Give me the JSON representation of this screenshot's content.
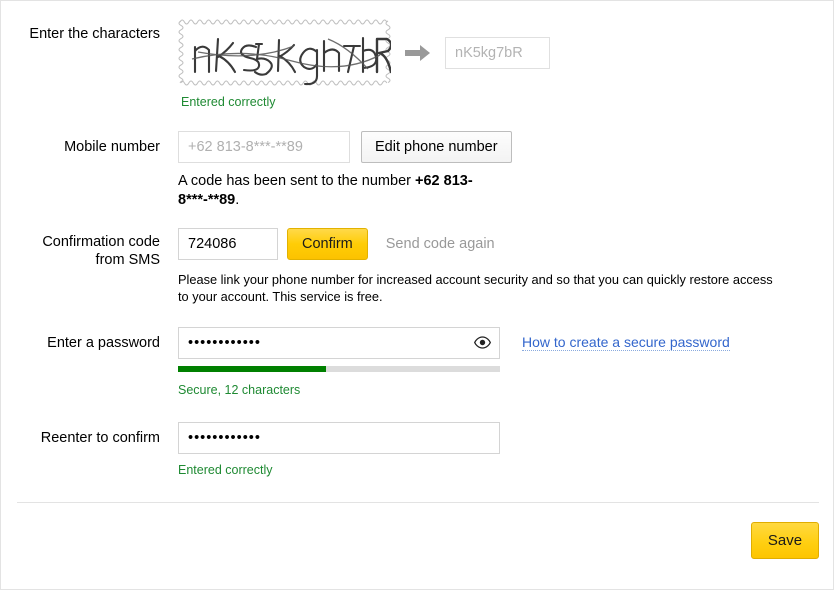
{
  "captcha": {
    "label": "Enter the characters",
    "image_text": "nK5kg7bR",
    "arrow_icon": "arrow-right-icon",
    "input_value": "nK5kg7bR",
    "status": "Entered correctly"
  },
  "mobile": {
    "label": "Mobile number",
    "input_value": "+62 813-8***-**89",
    "edit_button": "Edit phone number",
    "sent_note_prefix": "A code has been sent to the number ",
    "sent_note_number": "+62 813-8***-**89",
    "sent_note_suffix": "."
  },
  "sms": {
    "label_line1": "Confirmation code",
    "label_line2": "from SMS",
    "code_value": "724086",
    "confirm_button": "Confirm",
    "resend_link": "Send code again",
    "hint": "Please link your phone number for increased account security and so that you can quickly restore access to your account. This service is free."
  },
  "password": {
    "label": "Enter a password",
    "value": "••••••••••••",
    "eye_icon": "eye-icon",
    "strength_percent": 46,
    "strength_text": "Secure, 12 characters",
    "help_link": "How to create a secure password"
  },
  "confirm_password": {
    "label": "Reenter to confirm",
    "value": "••••••••••••",
    "status": "Entered correctly"
  },
  "footer": {
    "save_label": "Save"
  },
  "colors": {
    "success_green": "#1f8a33",
    "meter_green": "#008000",
    "accent_yellow": "#ffcd06",
    "link_blue": "#3366cc",
    "muted_gray": "#999999"
  }
}
